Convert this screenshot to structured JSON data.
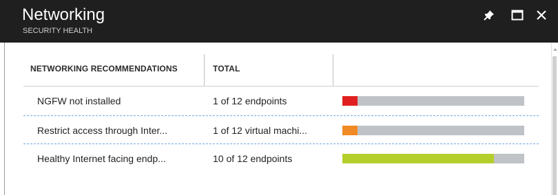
{
  "window": {
    "title": "Networking",
    "subtitle": "SECURITY HEALTH"
  },
  "header_buttons": [
    {
      "name": "pin-button",
      "icon": "pin-icon"
    },
    {
      "name": "maximize-button",
      "icon": "maximize-icon"
    },
    {
      "name": "close-button",
      "icon": "close-icon"
    }
  ],
  "table": {
    "columns": [
      "NETWORKING RECOMMENDATIONS",
      "TOTAL",
      ""
    ],
    "rows": [
      {
        "recommendation": "NGFW not installed",
        "total": "1 of 12 endpoints",
        "progress": 0.083,
        "color": "#e02020"
      },
      {
        "recommendation": "Restrict access through Inter...",
        "total": "1 of 12 virtual machi...",
        "progress": 0.083,
        "color": "#f08a24"
      },
      {
        "recommendation": "Healthy Internet facing endp...",
        "total": "10 of 12 endpoints",
        "progress": 0.833,
        "color": "#b4cf2c"
      }
    ]
  },
  "colors": {
    "header_bg": "#1f1f1f",
    "track": "#bfc3c8",
    "selection_border": "#6fa8dc"
  }
}
